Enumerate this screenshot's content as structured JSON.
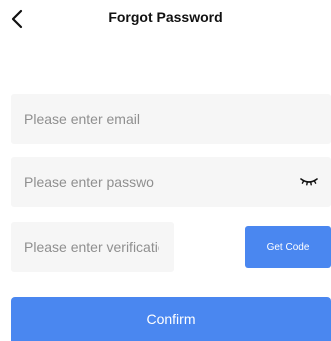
{
  "header": {
    "back_icon": "chevron-left-icon",
    "title": "Forgot Password"
  },
  "form": {
    "email": {
      "value": "",
      "placeholder": "Please enter email"
    },
    "password": {
      "value": "",
      "placeholder": "Please enter password",
      "toggle_icon": "eye-closed-icon"
    },
    "verification_code": {
      "value": "",
      "placeholder": "Please enter verification code"
    },
    "get_code_label": "Get Code",
    "confirm_label": "Confirm"
  },
  "colors": {
    "accent": "#4a87f0",
    "field_background": "#f6f6f6",
    "placeholder_text": "#8f8f8f",
    "title_text": "#111111"
  }
}
